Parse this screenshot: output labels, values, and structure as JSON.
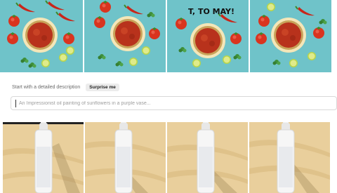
{
  "gallery_top": {
    "tiles": [
      {
        "overlay_text": ""
      },
      {
        "overlay_text": ""
      },
      {
        "overlay_text": "T, TO MAY!"
      },
      {
        "overlay_text": ""
      }
    ]
  },
  "prompt": {
    "description_label": "Start with a detailed description",
    "surprise_label": "Surprise me",
    "placeholder": "An Impressionist oil painting of sunflowers in a purple vase..."
  },
  "colors": {
    "teal_background": "#6fc3c9",
    "sand": "#e9cf9c",
    "salsa": "#b8321c"
  }
}
